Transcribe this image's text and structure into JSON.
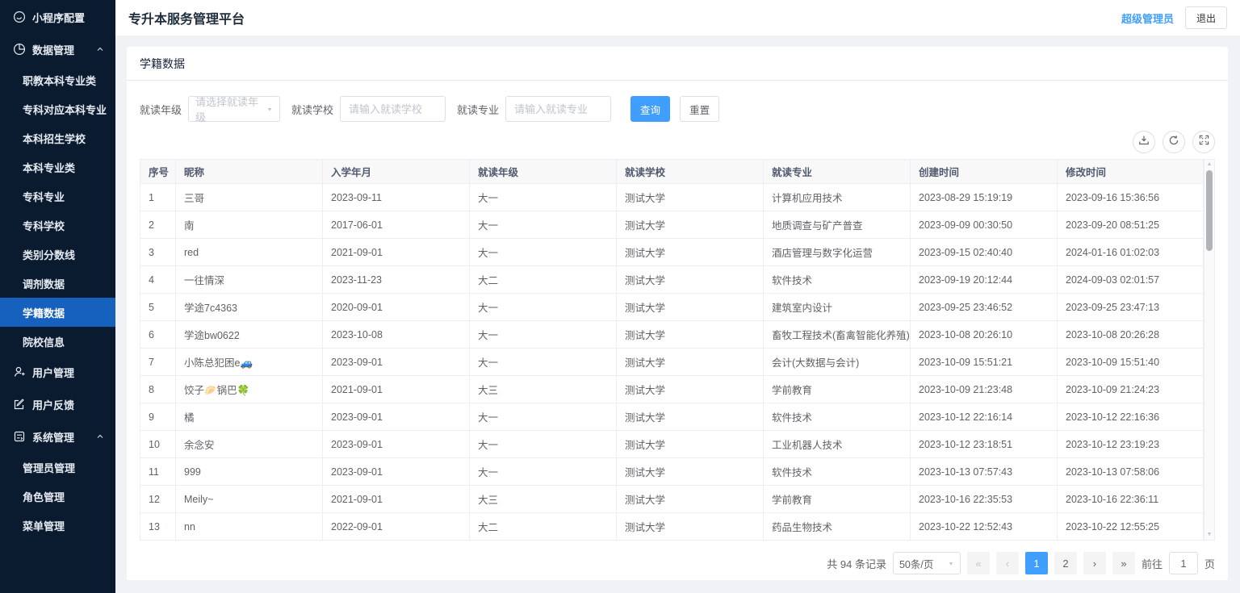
{
  "app": {
    "title": "专升本服务管理平台",
    "user_role": "超级管理员",
    "logout_label": "退出"
  },
  "colors": {
    "accent": "#409eff",
    "sidebar_bg": "#0a1a2f",
    "sidebar_active": "#1661bd"
  },
  "sidebar": {
    "items": [
      {
        "key": "miniprogram-config",
        "label": "小程序配置",
        "type": "top",
        "icon": "miniprogram-icon"
      },
      {
        "key": "data-management",
        "label": "数据管理",
        "type": "top",
        "icon": "data-icon",
        "arrow": true
      },
      {
        "key": "vocational-undergrad-major-category",
        "label": "职教本科专业类",
        "type": "sub"
      },
      {
        "key": "college-to-undergrad-major",
        "label": "专科对应本科专业",
        "type": "sub"
      },
      {
        "key": "undergrad-admission-school",
        "label": "本科招生学校",
        "type": "sub"
      },
      {
        "key": "undergrad-major-category",
        "label": "本科专业类",
        "type": "sub"
      },
      {
        "key": "college-major",
        "label": "专科专业",
        "type": "sub"
      },
      {
        "key": "college-school",
        "label": "专科学校",
        "type": "sub"
      },
      {
        "key": "category-score-line",
        "label": "类别分数线",
        "type": "sub"
      },
      {
        "key": "adjustment-data",
        "label": "调剂数据",
        "type": "sub"
      },
      {
        "key": "student-status-data",
        "label": "学籍数据",
        "type": "sub",
        "active": true
      },
      {
        "key": "institution-info",
        "label": "院校信息",
        "type": "sub"
      },
      {
        "key": "user-management",
        "label": "用户管理",
        "type": "top",
        "icon": "user-icon"
      },
      {
        "key": "user-feedback",
        "label": "用户反馈",
        "type": "top",
        "icon": "feedback-icon"
      },
      {
        "key": "system-management",
        "label": "系统管理",
        "type": "top",
        "icon": "system-icon",
        "arrow": true
      },
      {
        "key": "admin-management",
        "label": "管理员管理",
        "type": "sub"
      },
      {
        "key": "role-management",
        "label": "角色管理",
        "type": "sub"
      },
      {
        "key": "menu-management",
        "label": "菜单管理",
        "type": "sub"
      }
    ]
  },
  "card": {
    "title": "学籍数据"
  },
  "filters": {
    "grade_label": "就读年级",
    "grade_placeholder": "请选择就读年级",
    "school_label": "就读学校",
    "school_placeholder": "请输入就读学校",
    "major_label": "就读专业",
    "major_placeholder": "请输入就读专业",
    "search_label": "查询",
    "reset_label": "重置"
  },
  "table": {
    "columns": [
      "序号",
      "昵称",
      "入学年月",
      "就读年级",
      "就读学校",
      "就读专业",
      "创建时间",
      "修改时间"
    ],
    "column_keys": [
      "index",
      "nickname",
      "enroll-date",
      "grade",
      "school",
      "major",
      "created-at",
      "updated-at"
    ],
    "rows": [
      [
        "1",
        "三哥",
        "2023-09-11",
        "大一",
        "测试大学",
        "计算机应用技术",
        "2023-08-29 15:19:19",
        "2023-09-16 15:36:56"
      ],
      [
        "2",
        "南",
        "2017-06-01",
        "大一",
        "测试大学",
        "地质调查与矿产普查",
        "2023-09-09 00:30:50",
        "2023-09-20 08:51:25"
      ],
      [
        "3",
        "red",
        "2021-09-01",
        "大一",
        "测试大学",
        "酒店管理与数字化运营",
        "2023-09-15 02:40:40",
        "2024-01-16 01:02:03"
      ],
      [
        "4",
        "一往情深",
        "2023-11-23",
        "大二",
        "测试大学",
        "软件技术",
        "2023-09-19 20:12:44",
        "2024-09-03 02:01:57"
      ],
      [
        "5",
        "学途7c4363",
        "2020-09-01",
        "大一",
        "测试大学",
        "建筑室内设计",
        "2023-09-25 23:46:52",
        "2023-09-25 23:47:13"
      ],
      [
        "6",
        "学途bw0622",
        "2023-10-08",
        "大一",
        "测试大学",
        "畜牧工程技术(畜禽智能化养殖)",
        "2023-10-08 20:26:10",
        "2023-10-08 20:26:28"
      ],
      [
        "7",
        "小陈总犯困e🚙",
        "2023-09-01",
        "大一",
        "测试大学",
        "会计(大数据与会计)",
        "2023-10-09 15:51:21",
        "2023-10-09 15:51:40"
      ],
      [
        "8",
        "饺子🥟锅巴🍀",
        "2021-09-01",
        "大三",
        "测试大学",
        "学前教育",
        "2023-10-09 21:23:48",
        "2023-10-09 21:24:23"
      ],
      [
        "9",
        "橘",
        "2023-09-01",
        "大一",
        "测试大学",
        "软件技术",
        "2023-10-12 22:16:14",
        "2023-10-12 22:16:36"
      ],
      [
        "10",
        "余念安",
        "2023-09-01",
        "大一",
        "测试大学",
        "工业机器人技术",
        "2023-10-12 23:18:51",
        "2023-10-12 23:19:23"
      ],
      [
        "11",
        "999",
        "2023-09-01",
        "大一",
        "测试大学",
        "软件技术",
        "2023-10-13 07:57:43",
        "2023-10-13 07:58:06"
      ],
      [
        "12",
        "Meily~",
        "2021-09-01",
        "大三",
        "测试大学",
        "学前教育",
        "2023-10-16 22:35:53",
        "2023-10-16 22:36:11"
      ],
      [
        "13",
        "nn",
        "2022-09-01",
        "大二",
        "测试大学",
        "药品生物技术",
        "2023-10-22 12:52:43",
        "2023-10-22 12:55:25"
      ]
    ]
  },
  "pagination": {
    "total_text": "共 94 条记录",
    "page_size": "50条/页",
    "first_icon": "«",
    "prev_icon": "‹",
    "next_icon": "›",
    "last_icon": "»",
    "pages": [
      {
        "label": "1",
        "active": true
      },
      {
        "label": "2",
        "active": false
      }
    ],
    "goto_label": "前往",
    "goto_value": "1",
    "page_suffix": "页"
  }
}
